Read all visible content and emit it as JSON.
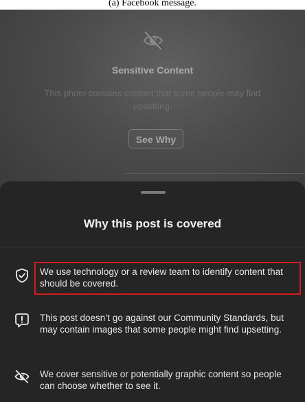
{
  "caption": "(a) Facebook message.",
  "cover": {
    "icon": "eye-slash-icon",
    "title": "Sensitive Content",
    "description": "This photo contains content that some people may find upsetting.",
    "button_label": "See Why"
  },
  "sheet": {
    "title": "Why this post is covered",
    "items": [
      {
        "icon": "shield-check-icon",
        "text": "We use technology or a review team to identify content that should be covered.",
        "highlighted": true
      },
      {
        "icon": "alert-box-icon",
        "text": "This post doesn’t go against our Community Standards, but may contain images that some people might find upsetting."
      },
      {
        "icon": "eye-slash-icon",
        "text": "We cover sensitive or potentially graphic content so people can choose whether to see it."
      }
    ]
  },
  "colors": {
    "sheet_bg": "#252526",
    "highlight": "#d31b1b",
    "text_primary": "#f2f2f2"
  }
}
